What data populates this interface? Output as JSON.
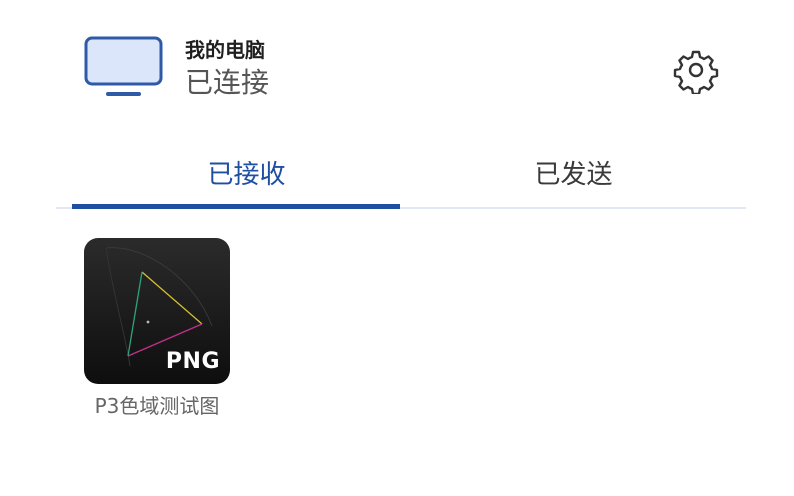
{
  "device": {
    "name": "我的电脑",
    "status": "已连接",
    "icon": "monitor-icon"
  },
  "settings": {
    "icon": "gear-icon"
  },
  "tabs": [
    {
      "label": "已接收",
      "active": true
    },
    {
      "label": "已发送",
      "active": false
    }
  ],
  "files": [
    {
      "name": "P3色域测试图",
      "type_badge": "PNG"
    }
  ],
  "colors": {
    "accent": "#1f4fa0",
    "monitor_fill": "#dbe6fb"
  }
}
